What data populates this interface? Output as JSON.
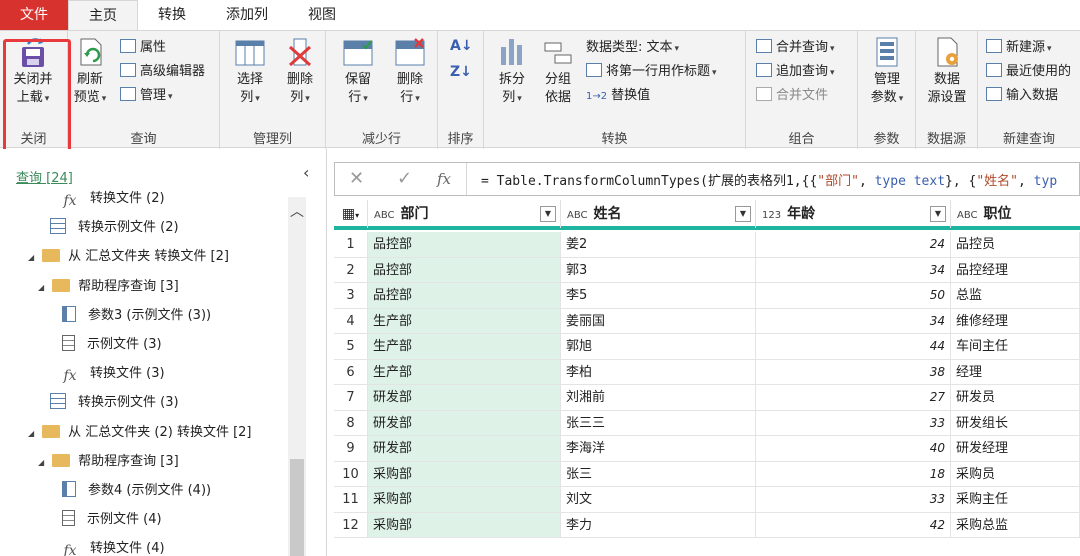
{
  "tabs": [
    "文件",
    "主页",
    "转换",
    "添加列",
    "视图"
  ],
  "ribbon": {
    "close": {
      "label1": "关闭并",
      "label2": "上载",
      "group": "关闭"
    },
    "query": {
      "refresh1": "刷新",
      "refresh2": "预览",
      "properties": "属性",
      "advanced": "高级编辑器",
      "manage": "管理",
      "group": "查询"
    },
    "cols": {
      "choose1": "选择",
      "choose2": "列",
      "remove1": "删除",
      "remove2": "列",
      "group": "管理列"
    },
    "rows": {
      "keep1": "保留",
      "keep2": "行",
      "remove1": "删除",
      "remove2": "行",
      "group": "减少行"
    },
    "sort": {
      "group": "排序"
    },
    "transform": {
      "split1": "拆分",
      "split2": "列",
      "groupby1": "分组",
      "groupby2": "依据",
      "datatype": "数据类型: 文本",
      "firstrow": "将第一行用作标题",
      "replace": "替换值",
      "group": "转换"
    },
    "combine": {
      "merge": "合并查询",
      "append": "追加查询",
      "files": "合并文件",
      "group": "组合"
    },
    "params": {
      "manage1": "管理",
      "manage2": "参数",
      "group": "参数"
    },
    "datasource": {
      "settings1": "数据",
      "settings2": "源设置",
      "group": "数据源"
    },
    "newquery": {
      "newsource": "新建源",
      "recent": "最近使用的",
      "enter": "输入数据",
      "group": "新建查询"
    }
  },
  "left": {
    "header": "查询 [24]",
    "items": [
      {
        "label": "转换文件 (2)",
        "icon": "fx-icon"
      },
      {
        "label": "转换示例文件 (2)",
        "icon": "table-icon"
      },
      {
        "label": "从 汇总文件夹 转换文件 [2]",
        "icon": "folder-icon"
      },
      {
        "label": "帮助程序查询 [3]",
        "icon": "folder-icon"
      },
      {
        "label": "参数3 (示例文件 (3))",
        "icon": "param-icon"
      },
      {
        "label": "示例文件 (3)",
        "icon": "doc-icon"
      },
      {
        "label": "转换文件 (3)",
        "icon": "fx-icon"
      },
      {
        "label": "转换示例文件 (3)",
        "icon": "table-icon"
      },
      {
        "label": "从 汇总文件夹 (2) 转换文件 [2]",
        "icon": "folder-icon"
      },
      {
        "label": "帮助程序查询 [3]",
        "icon": "folder-icon"
      },
      {
        "label": "参数4 (示例文件 (4))",
        "icon": "param-icon"
      },
      {
        "label": "示例文件 (4)",
        "icon": "doc-icon"
      },
      {
        "label": "转换文件 (4)",
        "icon": "fx-icon"
      }
    ]
  },
  "formula": {
    "prefix": "= Table.TransformColumnTypes(扩展的表格列1,{{",
    "s1": "\"部门\"",
    "mid1": ", ",
    "k1": "type text",
    "mid2": "}, {",
    "s2": "\"姓名\"",
    "mid3": ", ",
    "k2": "typ"
  },
  "table": {
    "columns": [
      {
        "type": "ABC",
        "name": "部门"
      },
      {
        "type": "ABC",
        "name": "姓名"
      },
      {
        "type": "123",
        "name": "年龄"
      },
      {
        "type": "ABC",
        "name": "职位"
      }
    ],
    "rows": [
      [
        "1",
        "品控部",
        "姜2",
        "24",
        "品控员"
      ],
      [
        "2",
        "品控部",
        "郭3",
        "34",
        "品控经理"
      ],
      [
        "3",
        "品控部",
        "李5",
        "50",
        "总监"
      ],
      [
        "4",
        "生产部",
        "姜丽国",
        "34",
        "维修经理"
      ],
      [
        "5",
        "生产部",
        "郭旭",
        "44",
        "车间主任"
      ],
      [
        "6",
        "生产部",
        "李柏",
        "38",
        "经理"
      ],
      [
        "7",
        "研发部",
        "刘湘前",
        "27",
        "研发员"
      ],
      [
        "8",
        "研发部",
        "张三三",
        "33",
        "研发组长"
      ],
      [
        "9",
        "研发部",
        "李海洋",
        "40",
        "研发经理"
      ],
      [
        "10",
        "采购部",
        "张三",
        "18",
        "采购员"
      ],
      [
        "11",
        "采购部",
        "刘文",
        "33",
        "采购主任"
      ],
      [
        "12",
        "采购部",
        "李力",
        "42",
        "采购总监"
      ]
    ]
  }
}
